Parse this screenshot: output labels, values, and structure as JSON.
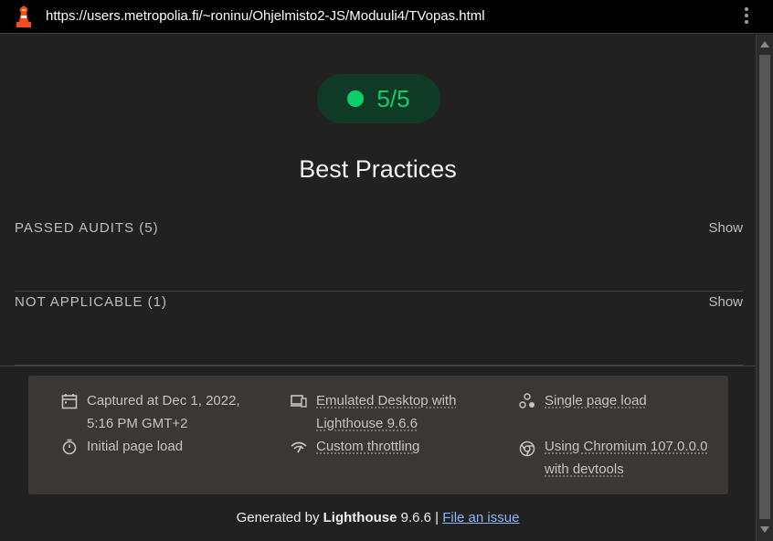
{
  "browser": {
    "url": "https://users.metropolia.fi/~roninu/Ohjelmisto2-JS/Moduuli4/TVopas.html"
  },
  "score": {
    "text": "5/5",
    "color": "#0cce6b"
  },
  "category": {
    "title": "Best Practices"
  },
  "groups": [
    {
      "label": "PASSED AUDITS (5)",
      "action": "Show"
    },
    {
      "label": "NOT APPLICABLE (1)",
      "action": "Show"
    }
  ],
  "env": {
    "captured_line1": "Captured at Dec 1, 2022,",
    "captured_line2": "5:16 PM GMT+2",
    "initial_load": "Initial page load",
    "emulated_line1": "Emulated Desktop with",
    "emulated_line2": "Lighthouse 9.6.6",
    "throttling": "Custom throttling",
    "single_load": "Single page load",
    "chromium_line1": "Using Chromium 107.0.0.0",
    "chromium_line2": "with devtools"
  },
  "footer": {
    "generated_by": "Generated by ",
    "product": "Lighthouse",
    "version": " 9.6.6 | ",
    "file_issue": "File an issue"
  }
}
